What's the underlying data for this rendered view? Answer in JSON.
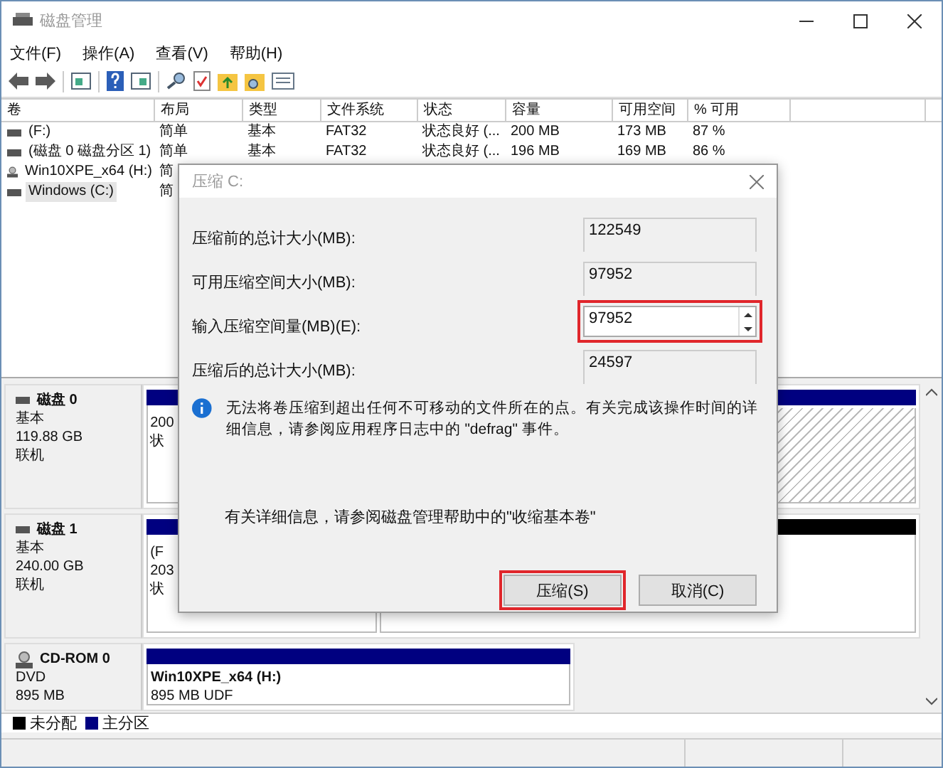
{
  "window": {
    "title": "磁盘管理"
  },
  "menu": [
    "文件(F)",
    "操作(A)",
    "查看(V)",
    "帮助(H)"
  ],
  "volume_table": {
    "columns": [
      "卷",
      "布局",
      "类型",
      "文件系统",
      "状态",
      "容量",
      "可用空间",
      "% 可用"
    ],
    "rows": [
      {
        "kind": "disk",
        "selected": false,
        "cells": [
          "(F:)",
          "简单",
          "基本",
          "FAT32",
          "状态良好 (...",
          "200 MB",
          "173 MB",
          "87 %"
        ]
      },
      {
        "kind": "disk",
        "selected": false,
        "cells": [
          "(磁盘 0 磁盘分区 1)",
          "简单",
          "基本",
          "FAT32",
          "状态良好 (...",
          "196 MB",
          "169 MB",
          "86 %"
        ]
      },
      {
        "kind": "cd",
        "selected": false,
        "cells": [
          "Win10XPE_x64 (H:)",
          "简"
        ]
      },
      {
        "kind": "disk",
        "selected": true,
        "cells": [
          "Windows (C:)",
          "简"
        ]
      }
    ]
  },
  "disks": [
    {
      "kind": "disk",
      "name": "磁盘 0",
      "type": "基本",
      "size": "119.88 GB",
      "status": "联机",
      "partitions": [
        {
          "kind": "primary",
          "selected": false,
          "lines": [
            "200",
            "状"
          ]
        },
        {
          "kind": "primary",
          "selected": true
        }
      ]
    },
    {
      "kind": "disk",
      "name": "磁盘 1",
      "type": "基本",
      "size": "240.00 GB",
      "status": "联机",
      "partitions": [
        {
          "kind": "primary",
          "selected": false,
          "lines": [
            "(F",
            "203",
            "状"
          ]
        },
        {
          "kind": "unallocated",
          "selected": false
        }
      ]
    },
    {
      "kind": "cd",
      "name": "CD-ROM 0",
      "type": "DVD",
      "size": "895 MB",
      "partitions": [
        {
          "kind": "primary",
          "selected": false,
          "lines": [
            "Win10XPE_x64 (H:)",
            "895 MB UDF"
          ]
        }
      ]
    }
  ],
  "legend": [
    {
      "label": "未分配",
      "color": "#000000"
    },
    {
      "label": "主分区",
      "color": "#000080"
    }
  ],
  "dialog": {
    "title": "压缩 C:",
    "fields": [
      {
        "kind": "readonly",
        "label": "压缩前的总计大小(MB):",
        "value": "122549",
        "highlighted": false
      },
      {
        "kind": "readonly",
        "label": "可用压缩空间大小(MB):",
        "value": "97952",
        "highlighted": false
      },
      {
        "kind": "spin",
        "label": "输入压缩空间量(MB)(E):",
        "value": "97952",
        "highlighted": true
      },
      {
        "kind": "readonly",
        "label": "压缩后的总计大小(MB):",
        "value": "24597",
        "highlighted": false
      }
    ],
    "info": "无法将卷压缩到超出任何不可移动的文件所在的点。有关完成该操作时间的详细信息，请参阅应用程序日志中的 \"defrag\" 事件。",
    "help": "有关详细信息，请参阅磁盘管理帮助中的\"收缩基本卷\"",
    "buttons": [
      {
        "label": "压缩(S)",
        "highlighted": true
      },
      {
        "label": "取消(C)",
        "highlighted": false
      }
    ]
  }
}
